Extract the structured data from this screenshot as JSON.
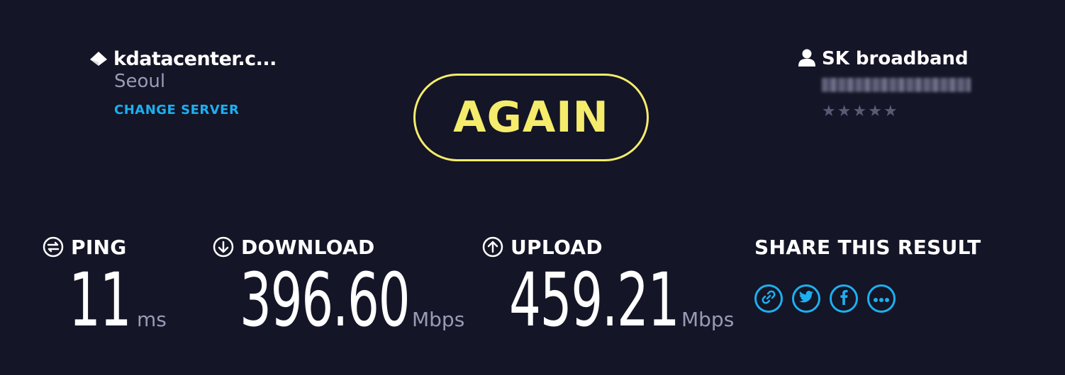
{
  "server": {
    "name": "kdatacenter.c...",
    "city": "Seoul",
    "change_label": "CHANGE SERVER",
    "icon": "server-icon"
  },
  "action": {
    "again_label": "AGAIN"
  },
  "isp": {
    "name": "SK broadband",
    "ip_redacted": "",
    "rating": 0,
    "rating_max": 5,
    "icon": "user-icon"
  },
  "metrics": {
    "ping": {
      "label": "PING",
      "value": "11",
      "unit": "ms",
      "icon": "ping-icon"
    },
    "download": {
      "label": "DOWNLOAD",
      "value": "396.60",
      "unit": "Mbps",
      "icon": "download-icon"
    },
    "upload": {
      "label": "UPLOAD",
      "value": "459.21",
      "unit": "Mbps",
      "icon": "upload-icon"
    }
  },
  "share": {
    "title": "SHARE THIS RESULT",
    "buttons": [
      {
        "name": "link",
        "icon": "link-icon"
      },
      {
        "name": "twitter",
        "icon": "twitter-icon"
      },
      {
        "name": "facebook",
        "icon": "facebook-icon"
      },
      {
        "name": "more",
        "icon": "more-icon"
      }
    ]
  },
  "colors": {
    "background": "#141526",
    "accent_yellow": "#f5ec6c",
    "accent_blue": "#1cb0f0",
    "muted_text": "#9a9ab6"
  }
}
